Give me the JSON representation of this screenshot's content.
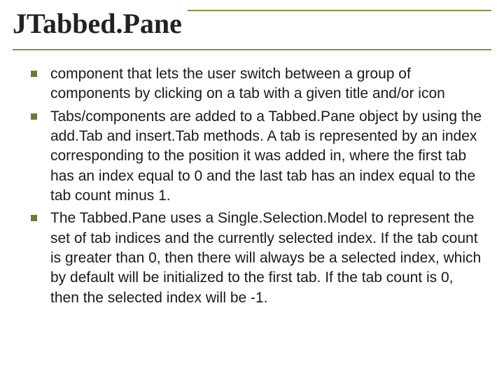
{
  "title": "JTabbed.Pane",
  "bullets": [
    "component that lets the user switch between a group of components by clicking on a tab with a given title and/or icon",
    "Tabs/components are added to a Tabbed.Pane object by using the add.Tab and insert.Tab methods. A tab is represented by an index corresponding to the position it was added in, where the first tab has an index equal to 0 and the last tab has an index equal to the tab count minus 1.",
    "The Tabbed.Pane uses a Single.Selection.Model to represent the set of tab indices and the currently selected index. If the tab count is greater than 0, then there will always be a selected index, which by default will be initialized to the first tab. If the tab count is 0, then the selected index will be -1."
  ]
}
